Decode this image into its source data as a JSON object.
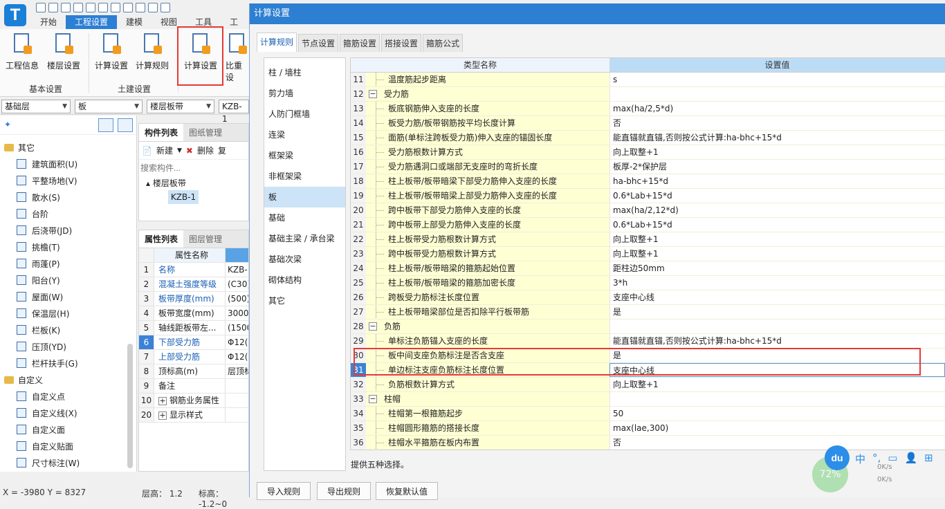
{
  "app": {
    "logo": "T",
    "quick_access_icons": [
      "save-icon",
      "new-icon",
      "open-icon",
      "undo-icon",
      "redo-icon",
      "sum-icon",
      "table-icon",
      "image-icon",
      "edit-icon",
      "grid-icon",
      "export-icon"
    ]
  },
  "menubar": {
    "tabs": [
      "开始",
      "工程设置",
      "建模",
      "视图",
      "工具",
      "工"
    ],
    "active": "工程设置"
  },
  "ribbon": {
    "buttons": [
      {
        "label": "工程信息",
        "icon": "project-info-icon"
      },
      {
        "label": "楼层设置",
        "icon": "floor-settings-icon"
      },
      {
        "label": "计算设置",
        "icon": "calc-settings-icon"
      },
      {
        "label": "计算规则",
        "icon": "calc-rules-icon"
      },
      {
        "label": "计算设置",
        "icon": "rebar-calc-settings-icon"
      },
      {
        "label": "比重设",
        "icon": "density-settings-icon"
      }
    ],
    "groups": [
      "基本设置",
      "土建设置"
    ]
  },
  "combos": [
    "基础层",
    "板",
    "楼层板带",
    "KZB-1"
  ],
  "left_tree": {
    "groups": [
      {
        "label": "其它",
        "items": [
          "建筑面积(U)",
          "平整场地(V)",
          "散水(S)",
          "台阶",
          "后浇带(JD)",
          "挑檐(T)",
          "雨蓬(P)",
          "阳台(Y)",
          "屋面(W)",
          "保温层(H)",
          "栏板(K)",
          "压顶(YD)",
          "栏杆扶手(G)"
        ]
      },
      {
        "label": "自定义",
        "items": [
          "自定义点",
          "自定义线(X)",
          "自定义面",
          "自定义贴面",
          "尺寸标注(W)"
        ]
      }
    ]
  },
  "component_panel": {
    "tabs": [
      "构件列表",
      "图纸管理"
    ],
    "new_label": "新建",
    "delete_label": "删除",
    "copy_label": "复",
    "search_placeholder": "搜索构件...",
    "tree_parent": "楼层板带",
    "tree_child": "KZB-1"
  },
  "attr_panel": {
    "tabs": [
      "属性列表",
      "图层管理"
    ],
    "header": "属性名称",
    "rows": [
      {
        "n": "1",
        "k": "名称",
        "v": "KZB-",
        "blue": true
      },
      {
        "n": "2",
        "k": "混凝土强度等级",
        "v": "(C30)",
        "blue": true
      },
      {
        "n": "3",
        "k": "板带厚度(mm)",
        "v": "(500)",
        "blue": true
      },
      {
        "n": "4",
        "k": "板带宽度(mm)",
        "v": "3000",
        "blue": false
      },
      {
        "n": "5",
        "k": "轴线距板带左...",
        "v": "(1500",
        "blue": false
      },
      {
        "n": "6",
        "k": "下部受力筋",
        "v": "Φ12(",
        "blue": true
      },
      {
        "n": "7",
        "k": "上部受力筋",
        "v": "Φ12(",
        "blue": true
      },
      {
        "n": "8",
        "k": "顶标高(m)",
        "v": "层顶标",
        "blue": false
      },
      {
        "n": "9",
        "k": "备注",
        "v": "",
        "blue": false
      },
      {
        "n": "10",
        "k": "钢筋业务属性",
        "v": "",
        "blue": false,
        "expand": "+"
      },
      {
        "n": "20",
        "k": "显示样式",
        "v": "",
        "blue": false,
        "expand": "+"
      }
    ]
  },
  "status": {
    "coords": "X = -3980 Y = 8327",
    "floor_height": "层高： 1.2",
    "elevation": "标高： -1.2~0"
  },
  "dialog": {
    "title": "计算设置",
    "tabs": [
      "计算规则",
      "节点设置",
      "箍筋设置",
      "搭接设置",
      "箍筋公式"
    ],
    "active_tab": "计算规则",
    "categories": [
      "柱 / 墙柱",
      "剪力墙",
      "人防门框墙",
      "连梁",
      "框架梁",
      "非框架梁",
      "板",
      "基础",
      "基础主梁 / 承台梁",
      "基础次梁",
      "砌体结构",
      "其它"
    ],
    "selected_category": "板",
    "grid_headers": [
      "类型名称",
      "设置值"
    ],
    "rows": [
      {
        "n": "11",
        "name": "温度筋起步距离",
        "value": "s"
      },
      {
        "n": "12",
        "name": "受力筋",
        "value": "",
        "group": true
      },
      {
        "n": "13",
        "name": "板底钢筋伸入支座的长度",
        "value": "max(ha/2,5*d)"
      },
      {
        "n": "14",
        "name": "板受力筋/板带钢筋按平均长度计算",
        "value": "否"
      },
      {
        "n": "15",
        "name": "面筋(单标注跨板受力筋)伸入支座的锚固长度",
        "value": "能直锚就直锚,否则按公式计算:ha-bhc+15*d"
      },
      {
        "n": "16",
        "name": "受力筋根数计算方式",
        "value": "向上取整+1"
      },
      {
        "n": "17",
        "name": "受力筋遇洞口或端部无支座时的弯折长度",
        "value": "板厚-2*保护层"
      },
      {
        "n": "18",
        "name": "柱上板带/板带暗梁下部受力筋伸入支座的长度",
        "value": "ha-bhc+15*d"
      },
      {
        "n": "19",
        "name": "柱上板带/板带暗梁上部受力筋伸入支座的长度",
        "value": "0.6*Lab+15*d"
      },
      {
        "n": "20",
        "name": "跨中板带下部受力筋伸入支座的长度",
        "value": "max(ha/2,12*d)"
      },
      {
        "n": "21",
        "name": "跨中板带上部受力筋伸入支座的长度",
        "value": "0.6*Lab+15*d"
      },
      {
        "n": "22",
        "name": "柱上板带受力筋根数计算方式",
        "value": "向上取整+1"
      },
      {
        "n": "23",
        "name": "跨中板带受力筋根数计算方式",
        "value": "向上取整+1"
      },
      {
        "n": "24",
        "name": "柱上板带/板带暗梁的箍筋起始位置",
        "value": "距柱边50mm"
      },
      {
        "n": "25",
        "name": "柱上板带/板带暗梁的箍筋加密长度",
        "value": "3*h"
      },
      {
        "n": "26",
        "name": "跨板受力筋标注长度位置",
        "value": "支座中心线"
      },
      {
        "n": "27",
        "name": "柱上板带暗梁部位是否扣除平行板带筋",
        "value": "是"
      },
      {
        "n": "28",
        "name": "负筋",
        "value": "",
        "group": true
      },
      {
        "n": "29",
        "name": "单标注负筋锚入支座的长度",
        "value": "能直锚就直锚,否则按公式计算:ha-bhc+15*d"
      },
      {
        "n": "30",
        "name": "板中间支座负筋标注是否含支座",
        "value": "是"
      },
      {
        "n": "31",
        "name": "单边标注支座负筋标注长度位置",
        "value": "支座中心线",
        "selected": true
      },
      {
        "n": "32",
        "name": "负筋根数计算方式",
        "value": "向上取整+1"
      },
      {
        "n": "33",
        "name": "柱帽",
        "value": "",
        "group": true
      },
      {
        "n": "34",
        "name": "柱帽第一根箍筋起步",
        "value": "50"
      },
      {
        "n": "35",
        "name": "柱帽圆形箍筋的搭接长度",
        "value": "max(lae,300)"
      },
      {
        "n": "36",
        "name": "柱帽水平箍筋在板内布置",
        "value": "否"
      }
    ],
    "description": "提供五种选择。",
    "buttons": [
      "导入规则",
      "导出规则",
      "恢复默认值"
    ]
  },
  "overlay": {
    "du": "du",
    "tray": [
      "中",
      "°,",
      "▭",
      "👤",
      "⊞"
    ],
    "speed_percent": "72%",
    "up": "0K/s",
    "down": "0K/s"
  }
}
